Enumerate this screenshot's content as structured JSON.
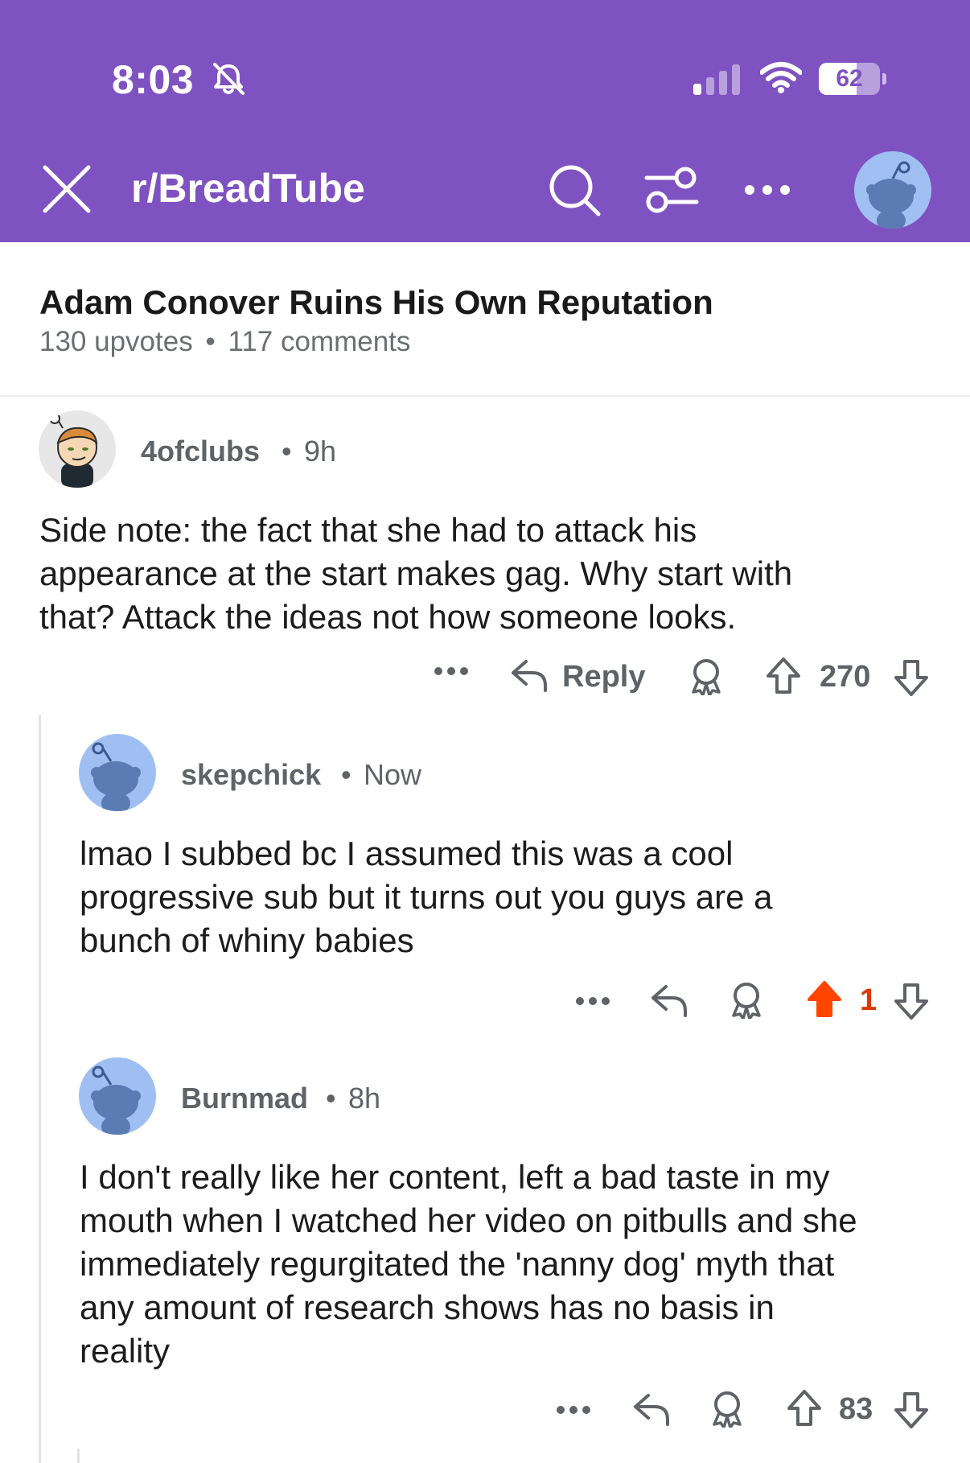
{
  "status_bar": {
    "time": "8:03",
    "battery_percent": "62",
    "battery_level": 0.62
  },
  "header": {
    "subreddit": "r/BreadTube",
    "icons": [
      "close-icon",
      "search-icon",
      "filter-icon",
      "more-icon",
      "avatar"
    ],
    "background": "#7f52c1"
  },
  "post": {
    "title": "Adam Conover Ruins His Own Reputation",
    "upvotes": "130 upvotes",
    "separator": "•",
    "comments": "117 comments"
  },
  "comments": [
    {
      "username": "4ofclubs",
      "time": "9h",
      "body": "Side note: the fact that she had to attack his\nappearance at the start makes gag. Why start with\nthat? Attack the ideas not how someone looks.",
      "reply_label": "Reply",
      "score": "270",
      "upvoted": false
    },
    {
      "username": "skepchick",
      "time": "Now",
      "body": "lmao I subbed bc I assumed this was a cool\nprogressive sub but it turns out you guys are a\nbunch of whiny babies",
      "score": "1",
      "upvoted": true
    },
    {
      "username": "Burnmad",
      "time": "8h",
      "body": "I don't really like her content, left a bad taste in my\nmouth when I watched her video on pitbulls and she\nimmediately regurgitated the 'nanny dog' myth that\nany amount of research shows has no basis in\nreality",
      "score": "83",
      "upvoted": false
    }
  ],
  "colors": {
    "accent": "#7f52c1",
    "upvote_active": "#ff4500",
    "meta_text": "#5f6368"
  }
}
